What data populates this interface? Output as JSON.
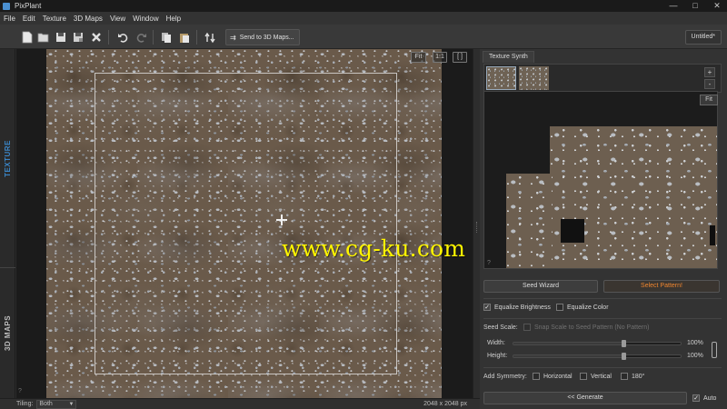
{
  "window": {
    "title": "PixPlant",
    "controls": [
      "—",
      "□",
      "✕"
    ]
  },
  "menu": [
    "File",
    "Edit",
    "Texture",
    "3D Maps",
    "View",
    "Window",
    "Help"
  ],
  "toolbar": {
    "send_label": "Send to 3D Maps...",
    "document_name": "Untitled*"
  },
  "left_tabs": {
    "texture": "TEXTURE",
    "maps": "3D MAPS"
  },
  "viewport": {
    "fit_label": "Fit",
    "one_to_one_label": "1:1",
    "full_label": "[ ]",
    "watermark": "www.cg-ku.com",
    "help": "?"
  },
  "status": {
    "tiling_label": "Tiling:",
    "tiling_value": "Both",
    "dimensions": "2048 x 2048 px"
  },
  "panel": {
    "tab": "Texture Synth",
    "plus": "+",
    "minus": "-",
    "fit_label": "Fit",
    "help": "?",
    "seed_wizard": "Seed Wizard",
    "select_pattern": "Select Pattern!",
    "equalize_brightness": {
      "label": "Equalize Brightness",
      "checked": true
    },
    "equalize_color": {
      "label": "Equalize Color",
      "checked": false
    },
    "seed_scale_label": "Seed Scale:",
    "snap_scale": "Snap Scale to Seed Pattern (No Pattern)",
    "width": {
      "label": "Width:",
      "value": "100%",
      "level": 0.66
    },
    "height": {
      "label": "Height:",
      "value": "100%",
      "level": 0.66
    },
    "symmetry_label": "Add Symmetry:",
    "horizontal": "Horizontal",
    "vertical": "Vertical",
    "deg180": "180°",
    "generate": "<< Generate",
    "auto": {
      "label": "Auto",
      "checked": true
    }
  }
}
